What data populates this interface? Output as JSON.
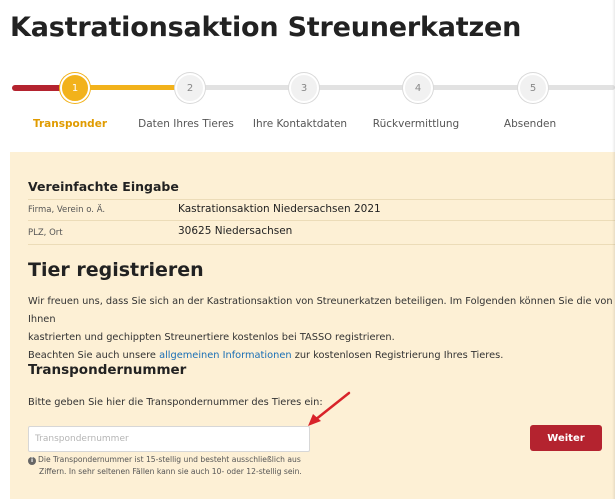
{
  "page": {
    "title": "Kastrationsaktion Streunerkatzen"
  },
  "stepper": {
    "steps": [
      {
        "number": "1",
        "label": "Transponder"
      },
      {
        "number": "2",
        "label": "Daten Ihres Tieres"
      },
      {
        "number": "3",
        "label": "Ihre Kontaktdaten"
      },
      {
        "number": "4",
        "label": "Rückvermittlung"
      },
      {
        "number": "5",
        "label": "Absenden"
      }
    ]
  },
  "simplified": {
    "title": "Vereinfachte Eingabe",
    "rows": [
      {
        "label": "Firma, Verein o. Ä.",
        "value": "Kastrationsaktion Niedersachsen 2021"
      },
      {
        "label": "PLZ, Ort",
        "value": "30625 Niedersachsen"
      }
    ]
  },
  "register": {
    "title": "Tier registrieren",
    "intro_line1": "Wir freuen uns, dass Sie sich an der Kastrationsaktion von Streunerkatzen beteiligen. Im Folgenden können Sie die von Ihnen",
    "intro_line2": "kastrierten und gechippten Streunertiere kostenlos bei TASSO registrieren.",
    "intro_line3_pre": "Beachten Sie auch unsere",
    "intro_link": "allgemeinen Informationen",
    "intro_line3_post": "zur kostenlosen Registrierung Ihres Tieres."
  },
  "transponder": {
    "title": "Transpondernummer",
    "prompt": "Bitte geben Sie hier die Transpondernummer des Tieres ein:",
    "placeholder": "Transpondernummer",
    "value": "",
    "hint_line1": "Die Transpondernummer ist 15-stellig und besteht ausschließlich aus",
    "hint_line2": "Ziffern. In sehr seltenen Fällen kann sie auch 10- oder 12-stellig sein.",
    "submit_label": "Weiter"
  },
  "icons": {
    "info": "info-icon",
    "annotation_arrow": "red-arrow-icon"
  },
  "colors": {
    "brand_red": "#b4232f",
    "accent_yellow": "#f2b21b",
    "panel_bg": "#fdf0d5",
    "link": "#1a6fb5"
  }
}
